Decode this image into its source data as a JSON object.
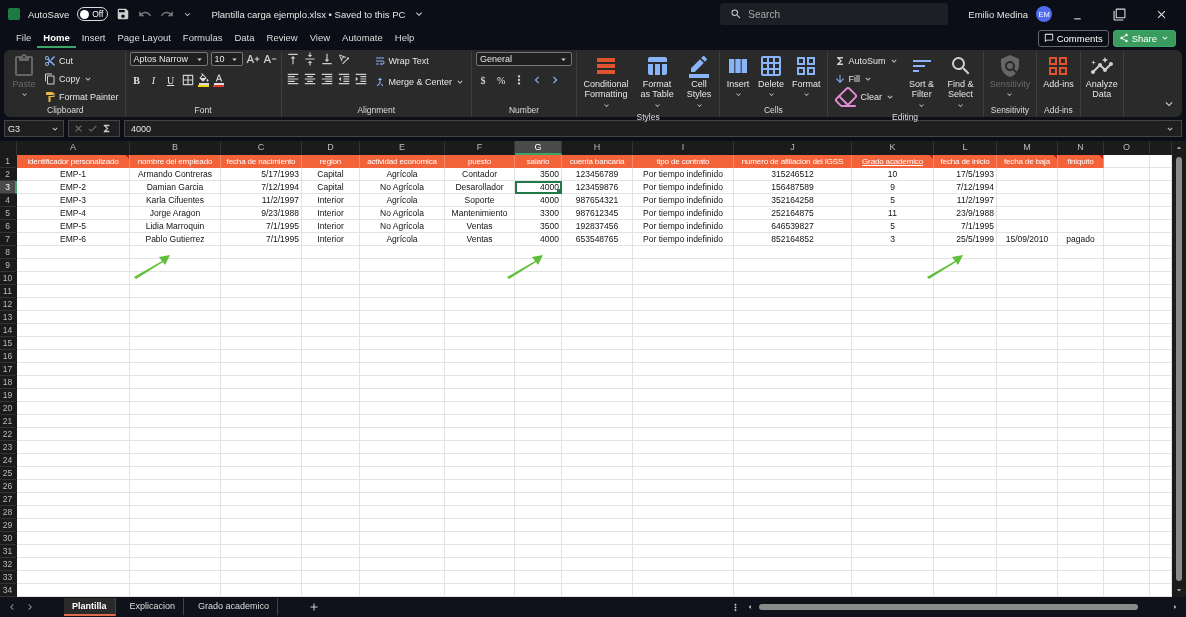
{
  "title_bar": {
    "autosave_label": "AutoSave",
    "autosave": {
      "on": false,
      "label": "Off"
    },
    "file_title": "Plantilla carga ejemplo.xlsx • Saved to this PC",
    "search_placeholder": "Search",
    "user_name": "Emilio Medina",
    "user_initials": "EM"
  },
  "menu_tabs": [
    {
      "label": "File",
      "selected": false
    },
    {
      "label": "Home",
      "selected": true
    },
    {
      "label": "Insert",
      "selected": false
    },
    {
      "label": "Page Layout",
      "selected": false
    },
    {
      "label": "Formulas",
      "selected": false
    },
    {
      "label": "Data",
      "selected": false
    },
    {
      "label": "Review",
      "selected": false
    },
    {
      "label": "View",
      "selected": false
    },
    {
      "label": "Automate",
      "selected": false
    },
    {
      "label": "Help",
      "selected": false
    }
  ],
  "comments_button": "Comments",
  "share_button": "Share",
  "ribbon": {
    "groups": [
      {
        "kind": "clipboard",
        "label": "Clipboard",
        "items": [
          {
            "label": "Paste",
            "disabled": true
          },
          {
            "label": "Cut",
            "disabled": false
          },
          {
            "label": "Copy",
            "disabled": false
          },
          {
            "label": "Format Painter",
            "disabled": false
          }
        ]
      },
      {
        "kind": "font",
        "label": "Font",
        "items": [
          {
            "label": "Aptos Narrow"
          },
          {
            "label": "10"
          },
          {
            "label": "B"
          },
          {
            "label": "I"
          },
          {
            "label": "U"
          }
        ]
      },
      {
        "kind": "alignment",
        "label": "Alignment",
        "items": [
          {
            "label": "Wrap Text"
          },
          {
            "label": "Merge & Center"
          }
        ]
      },
      {
        "kind": "number",
        "label": "Number",
        "items": [
          {
            "label": "General"
          },
          {
            "label": "$"
          },
          {
            "label": "%"
          }
        ]
      },
      {
        "kind": "styles",
        "label": "Styles",
        "items": [
          {
            "label": "Conditional Formatting"
          },
          {
            "label": "Format as Table"
          },
          {
            "label": "Cell Styles"
          }
        ]
      },
      {
        "kind": "cells",
        "label": "Cells",
        "items": [
          {
            "label": "Insert"
          },
          {
            "label": "Delete"
          },
          {
            "label": "Format"
          }
        ]
      },
      {
        "kind": "editing",
        "label": "Editing",
        "items": [
          {
            "label": "AutoSum"
          },
          {
            "label": "Fill"
          },
          {
            "label": "Clear"
          },
          {
            "label": "Sort & Filter"
          },
          {
            "label": "Find & Select"
          }
        ]
      },
      {
        "kind": "sensitivity",
        "label": "Sensitivity",
        "items": [
          {
            "label": "Sensitivity",
            "disabled": true
          }
        ]
      },
      {
        "kind": "addins",
        "label": "Add-ins",
        "items": [
          {
            "label": "Add-ins"
          }
        ]
      },
      {
        "kind": "analyze",
        "items": [
          {
            "label": "Analyze Data"
          }
        ]
      }
    ]
  },
  "formula_bar": {
    "name_box": "G3",
    "value": "4000"
  },
  "sheet": {
    "columns": [
      {
        "letter": "A",
        "selected": false
      },
      {
        "letter": "B",
        "selected": false
      },
      {
        "letter": "C",
        "selected": false
      },
      {
        "letter": "D",
        "selected": false
      },
      {
        "letter": "E",
        "selected": false
      },
      {
        "letter": "F",
        "selected": false
      },
      {
        "letter": "G",
        "selected": true
      },
      {
        "letter": "H",
        "selected": false
      },
      {
        "letter": "I",
        "selected": false
      },
      {
        "letter": "J",
        "selected": false
      },
      {
        "letter": "K",
        "selected": false
      },
      {
        "letter": "L",
        "selected": false
      },
      {
        "letter": "M",
        "selected": false
      },
      {
        "letter": "N",
        "selected": false
      },
      {
        "letter": "O",
        "selected": false
      }
    ],
    "header_row": {
      "number": "1",
      "selected": false,
      "cells": [
        {
          "text": "identificador personalizado",
          "underlined": false,
          "note": true
        },
        {
          "text": "nombre del empleado",
          "underlined": false,
          "note": false
        },
        {
          "text": "fecha de nacimiento",
          "underlined": false,
          "note": false
        },
        {
          "text": "region",
          "underlined": false,
          "note": false
        },
        {
          "text": "actividad economica",
          "underlined": false,
          "note": false
        },
        {
          "text": "puesto",
          "underlined": false,
          "note": false
        },
        {
          "text": "salario",
          "underlined": false,
          "note": false
        },
        {
          "text": "cuenta bancaria",
          "underlined": false,
          "note": false
        },
        {
          "text": "tipo de contrato",
          "underlined": false,
          "note": false
        },
        {
          "text": "numero de afiliacion del IGSS",
          "underlined": false,
          "note": false
        },
        {
          "text": "Grado academico",
          "underlined": true,
          "note": true
        },
        {
          "text": "fecha de inicio",
          "underlined": false,
          "note": false
        },
        {
          "text": "fecha de baja",
          "underlined": false,
          "note": true
        },
        {
          "text": "finiquito",
          "underlined": false,
          "note": true
        }
      ]
    },
    "rows": [
      {
        "number": "2",
        "selected": false,
        "cells": [
          "EMP-1",
          "Armando Contreras",
          "5/17/1993",
          "Capital",
          "Agrícola",
          "Contador",
          "3500",
          "123456789",
          "Por tiempo indefinido",
          "315246512",
          "10",
          "17/5/1993"
        ]
      },
      {
        "number": "3",
        "selected": true,
        "cells": [
          "EMP-2",
          "Damian Garcia",
          "7/12/1994",
          "Capital",
          "No Agrícola",
          "Desarollador",
          "4000",
          "123459876",
          "Por tiempo indefinido",
          "156487589",
          "9",
          "7/12/1994"
        ]
      },
      {
        "number": "4",
        "selected": false,
        "cells": [
          "EMP-3",
          "Karla Cifuentes",
          "11/2/1997",
          "Interior",
          "Agrícola",
          "Soporte",
          "4000",
          "987654321",
          "Por tiempo indefinido",
          "352164258",
          "5",
          "11/2/1997"
        ]
      },
      {
        "number": "5",
        "selected": false,
        "cells": [
          "EMP-4",
          "Jorge Aragon",
          "9/23/1988",
          "Interior",
          "No Agrícola",
          "Mantenimiento",
          "3300",
          "987612345",
          "Por tiempo indefinido",
          "252164875",
          "11",
          "23/9/1988"
        ]
      },
      {
        "number": "6",
        "selected": false,
        "cells": [
          "EMP-5",
          "Lidia Marroquin",
          "7/1/1995",
          "Interior",
          "No Agrícola",
          "Ventas",
          "3500",
          "192837456",
          "Por tiempo indefinido",
          "646539827",
          "5",
          "7/1/1995"
        ]
      },
      {
        "number": "7",
        "selected": false,
        "cells": [
          "EMP-6",
          "Pablo Gutierrez",
          "7/1/1995",
          "Interior",
          "Agrícola",
          "Ventas",
          "4000",
          "653548765",
          "Por tiempo indefinido",
          "852164852",
          "3",
          "25/5/1999",
          "15/09/2010",
          "pagado"
        ]
      }
    ],
    "empty_rows": [
      "8",
      "9",
      "10",
      "11",
      "12",
      "13",
      "14",
      "15",
      "16",
      "17",
      "18",
      "19",
      "20",
      "21",
      "22",
      "23",
      "24",
      "25",
      "26",
      "27",
      "28",
      "29",
      "30",
      "31",
      "32",
      "33",
      "34"
    ]
  },
  "sheet_tabs": [
    {
      "label": "Plantilla",
      "selected": true
    },
    {
      "label": "Explicacion",
      "selected": false
    },
    {
      "label": "Grado academico",
      "selected": false
    }
  ]
}
